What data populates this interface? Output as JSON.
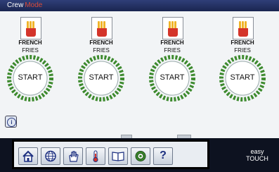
{
  "header": {
    "title": "Crew",
    "mode": "Mode"
  },
  "slots": [
    {
      "name_line1": "FRENCH",
      "name_line2": "FRIES",
      "button": "START"
    },
    {
      "name_line1": "FRENCH",
      "name_line2": "FRIES",
      "button": "START"
    },
    {
      "name_line1": "FRENCH",
      "name_line2": "FRIES",
      "button": "START"
    },
    {
      "name_line1": "FRENCH",
      "name_line2": "FRIES",
      "button": "START"
    }
  ],
  "toolbar": {
    "icons": [
      "home-icon",
      "globe-icon",
      "hand-icon",
      "thermometer-icon",
      "book-icon",
      "recycle-icon",
      "help-icon"
    ],
    "help_label": "?"
  },
  "info_icon": "i",
  "logo": {
    "line1": "easy",
    "line2": "TOUCH"
  },
  "colors": {
    "header": "#2f3f78",
    "ring": "#3d8a2e",
    "accent": "#d84a3a"
  }
}
